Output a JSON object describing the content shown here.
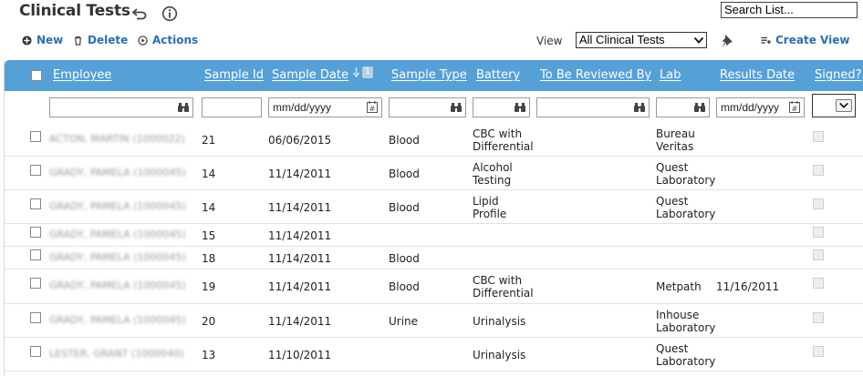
{
  "page": {
    "title": "Clinical Tests",
    "search_placeholder": "Search List..."
  },
  "toolbar": {
    "new_label": "New",
    "delete_label": "Delete",
    "actions_label": "Actions",
    "view_label": "View",
    "view_selected": "All Clinical Tests",
    "create_view_label": "Create View"
  },
  "accent_color": "#56a0d8",
  "link_color": "#2a6fb3",
  "columns": {
    "employee": "Employee",
    "sample_id": "Sample Id",
    "sample_date": "Sample Date",
    "sample_type": "Sample Type",
    "battery": "Battery",
    "reviewer": "To Be Reviewed By",
    "lab": "Lab",
    "results_date": "Results Date",
    "signed": "Signed?"
  },
  "sort": {
    "column": "Sample Date",
    "direction": "descending",
    "priority": "1"
  },
  "filters": {
    "sample_date_placeholder": "mm/dd/yyyy",
    "results_date_placeholder": "mm/dd/yyyy"
  },
  "rows": [
    {
      "employee": "ACTON, MARTIN (1000022)",
      "sample_id": "21",
      "sample_date": "06/06/2015",
      "sample_type": "Blood",
      "battery_1": "CBC with",
      "battery_2": "Differential",
      "lab_1": "Bureau",
      "lab_2": "Veritas",
      "results_date": ""
    },
    {
      "employee": "GRADY, PAMELA (1000045)",
      "sample_id": "14",
      "sample_date": "11/14/2011",
      "sample_type": "Blood",
      "battery_1": "Alcohol",
      "battery_2": "Testing",
      "lab_1": "Quest",
      "lab_2": "Laboratory",
      "results_date": ""
    },
    {
      "employee": "GRADY, PAMELA (1000045)",
      "sample_id": "14",
      "sample_date": "11/14/2011",
      "sample_type": "Blood",
      "battery_1": "Lipid",
      "battery_2": "Profile",
      "lab_1": "Quest",
      "lab_2": "Laboratory",
      "results_date": ""
    },
    {
      "employee": "GRADY, PAMELA (1000045)",
      "sample_id": "15",
      "sample_date": "11/14/2011",
      "sample_type": "",
      "battery_1": "",
      "battery_2": "",
      "lab_1": "",
      "lab_2": "",
      "results_date": ""
    },
    {
      "employee": "GRADY, PAMELA (1000045)",
      "sample_id": "18",
      "sample_date": "11/14/2011",
      "sample_type": "Blood",
      "battery_1": "",
      "battery_2": "",
      "lab_1": "",
      "lab_2": "",
      "results_date": ""
    },
    {
      "employee": "GRADY, PAMELA (1000045)",
      "sample_id": "19",
      "sample_date": "11/14/2011",
      "sample_type": "Blood",
      "battery_1": "CBC with",
      "battery_2": "Differential",
      "lab_1": "Metpath",
      "lab_2": "",
      "results_date": "11/16/2011"
    },
    {
      "employee": "GRADY, PAMELA (1000045)",
      "sample_id": "20",
      "sample_date": "11/14/2011",
      "sample_type": "Urine",
      "battery_1": "Urinalysis",
      "battery_2": "",
      "lab_1": "Inhouse",
      "lab_2": "Laboratory",
      "results_date": ""
    },
    {
      "employee": "LESTER, GRANT (1000040)",
      "sample_id": "13",
      "sample_date": "11/10/2011",
      "sample_type": "",
      "battery_1": "Urinalysis",
      "battery_2": "",
      "lab_1": "Quest",
      "lab_2": "Laboratory",
      "results_date": ""
    }
  ]
}
